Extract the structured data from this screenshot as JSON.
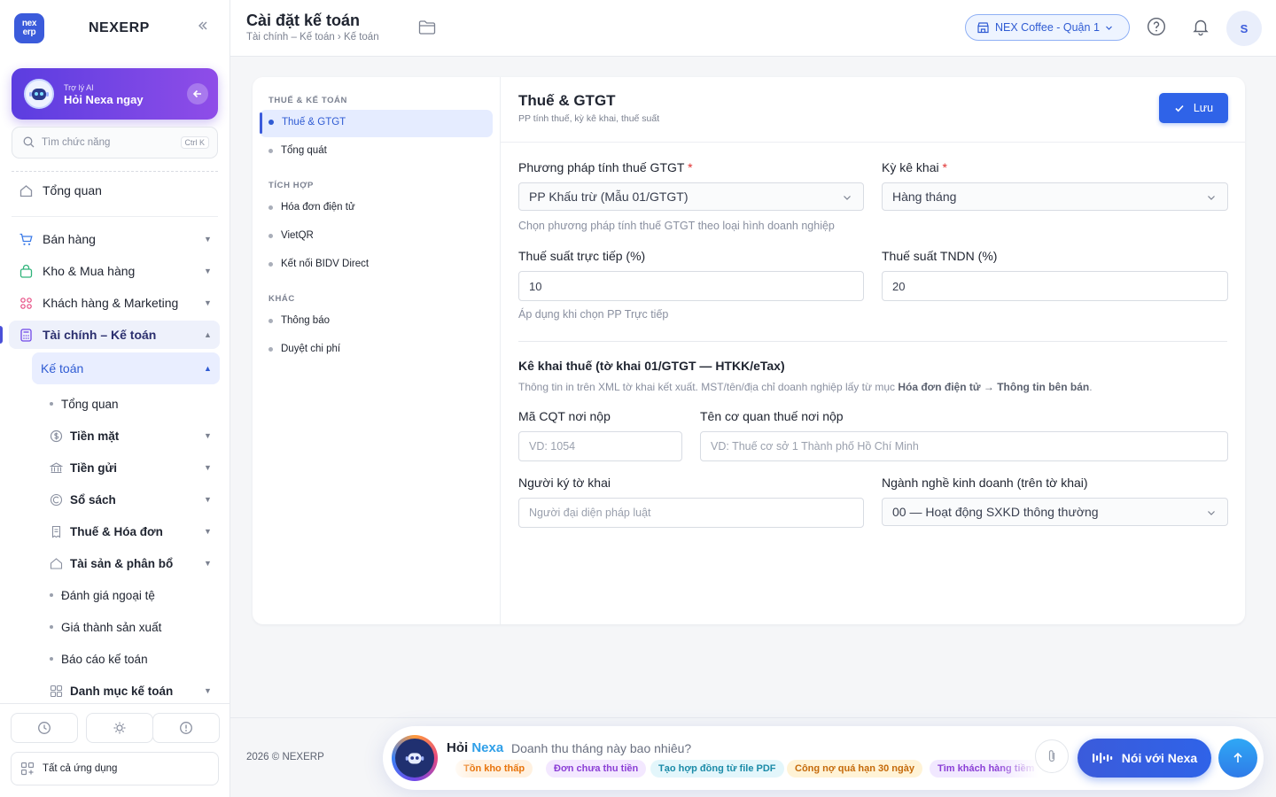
{
  "sidebar": {
    "logo_text": "nex erp",
    "brand": "NEXERP",
    "ai": {
      "subtitle": "Trợ lý AI",
      "title": "Hỏi Nexa ngay"
    },
    "search": {
      "placeholder": "Tìm chức năng",
      "shortcut": "Ctrl K"
    },
    "overview": "Tổng quan",
    "groups": [
      {
        "label": "Bán hàng",
        "icon": "cart-icon"
      },
      {
        "label": "Kho & Mua hàng",
        "icon": "bag-icon"
      },
      {
        "label": "Khách hàng & Marketing",
        "icon": "users-icon"
      },
      {
        "label": "Tài chính – Kế toán",
        "icon": "calculator-icon"
      }
    ],
    "sub_group": "Kế toán",
    "sub_items": [
      {
        "label": "Tổng quan",
        "icon": "dot",
        "caret": false
      },
      {
        "label": "Tiền mặt",
        "icon": "cash-icon",
        "caret": true
      },
      {
        "label": "Tiền gửi",
        "icon": "bank-icon",
        "caret": true
      },
      {
        "label": "Sổ sách",
        "icon": "ledger-icon",
        "caret": true
      },
      {
        "label": "Thuế & Hóa đơn",
        "icon": "invoice-icon",
        "caret": true
      },
      {
        "label": "Tài sản & phân bổ",
        "icon": "asset-icon",
        "caret": true
      },
      {
        "label": "Đánh giá ngoại tệ",
        "icon": "dot",
        "caret": false
      },
      {
        "label": "Giá thành sản xuất",
        "icon": "dot",
        "caret": false
      },
      {
        "label": "Báo cáo kế toán",
        "icon": "dot",
        "caret": false
      },
      {
        "label": "Danh mục kế toán",
        "icon": "grid-icon",
        "caret": true
      }
    ],
    "all_apps": "Tất cả ứng dụng"
  },
  "topbar": {
    "title": "Cài đặt kế toán",
    "breadcrumb": "Tài chính – Kế toán › Kế toán",
    "store": "NEX Coffee - Quận 1",
    "avatar": "S"
  },
  "settings_nav": {
    "sections": [
      {
        "title": "THUẾ & KẾ TOÁN",
        "items": [
          "Thuế & GTGT",
          "Tổng quát"
        ]
      },
      {
        "title": "TÍCH HỢP",
        "items": [
          "Hóa đơn điện tử",
          "VietQR",
          "Kết nối BIDV Direct"
        ]
      },
      {
        "title": "KHÁC",
        "items": [
          "Thông báo",
          "Duyệt chi phí"
        ]
      }
    ],
    "active": "Thuế & GTGT"
  },
  "form": {
    "title": "Thuế & GTGT",
    "subtitle": "PP tính thuế, kỳ kê khai, thuế suất",
    "save": "Lưu",
    "vat_method": {
      "label": "Phương pháp tính thuế GTGT",
      "value": "PP Khấu trừ (Mẫu 01/GTGT)",
      "hint": "Chọn phương pháp tính thuế GTGT theo loại hình doanh nghiệp"
    },
    "period": {
      "label": "Kỳ kê khai",
      "value": "Hàng tháng"
    },
    "direct_rate": {
      "label": "Thuế suất trực tiếp (%)",
      "value": "10",
      "hint": "Áp dụng khi chọn PP Trực tiếp"
    },
    "cit_rate": {
      "label": "Thuế suất TNDN (%)",
      "value": "20"
    },
    "declaration": {
      "title": "Kê khai thuế (tờ khai 01/GTGT — HTKK/eTax)",
      "desc_pre": "Thông tin in trên XML tờ khai kết xuất. MST/tên/địa chỉ doanh nghiệp lấy từ mục ",
      "desc_bold": "Hóa đơn điện tử → Thông tin bên bán",
      "desc_post": "."
    },
    "tax_code": {
      "label": "Mã CQT nơi nộp",
      "placeholder": "VD: 1054"
    },
    "tax_office": {
      "label": "Tên cơ quan thuế nơi nộp",
      "placeholder": "VD: Thuế cơ sở 1 Thành phố Hồ Chí Minh"
    },
    "signer": {
      "label": "Người ký tờ khai",
      "placeholder": "Người đại diện pháp luật"
    },
    "industry": {
      "label": "Ngành nghề kinh doanh (trên tờ khai)",
      "value": "00 — Hoạt động SXKD thông thường"
    }
  },
  "footer": {
    "copyright": "2026 © NEXERP"
  },
  "chat": {
    "hoi": "Hỏi",
    "nexa": "Nexa",
    "question": "Doanh thu tháng này bao nhiêu?",
    "chips": [
      "Tồn kho thấp",
      "Đơn chưa thu tiền",
      "Tạo hợp đồng từ file PDF",
      "Công nợ quá hạn 30 ngày",
      "Tìm khách hàng tiềm năng"
    ],
    "talk": "Nói với Nexa"
  },
  "colors": {
    "accent": "#2f63e8",
    "ai_gradient": "#5b3de0",
    "required": "#e03131"
  }
}
